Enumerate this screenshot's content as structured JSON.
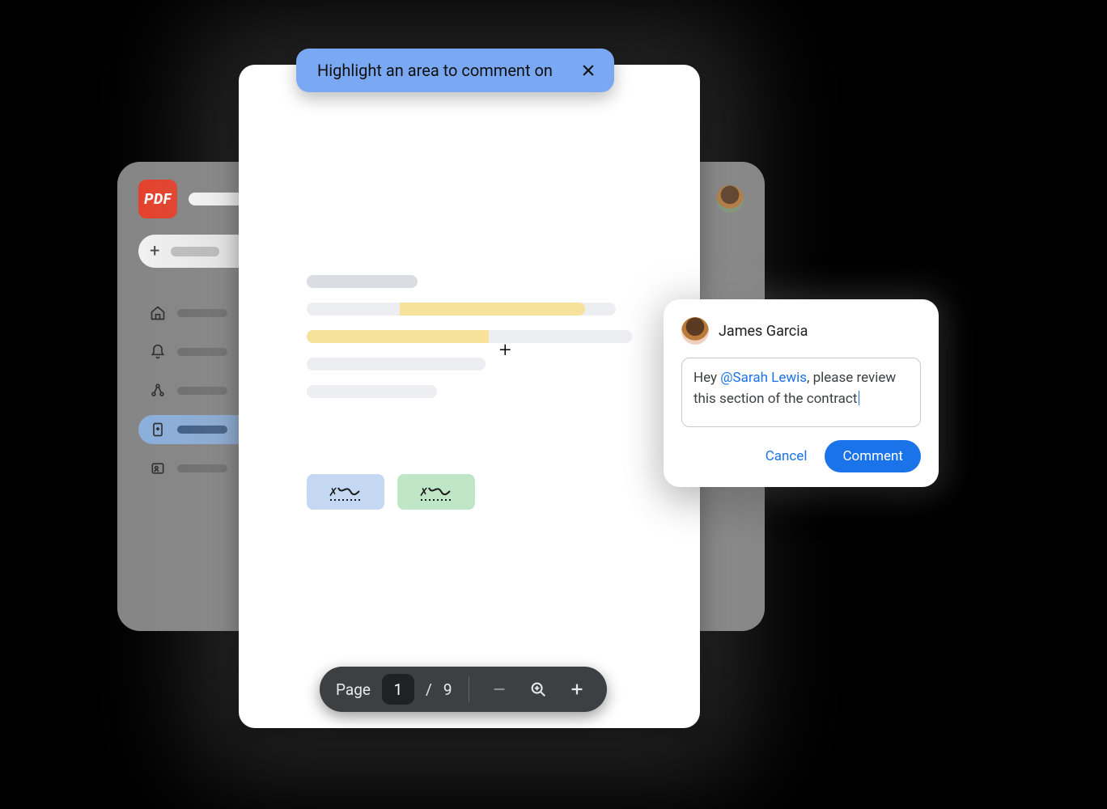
{
  "app": {
    "logo_text": "PDF"
  },
  "banner": {
    "text": "Highlight an area to comment on"
  },
  "pager": {
    "label": "Page",
    "current": "1",
    "separator": "/",
    "total": "9"
  },
  "comment": {
    "author": "James Garcia",
    "text_pre": "Hey ",
    "mention": "@Sarah Lewis",
    "text_post": ", please review this section of the contract",
    "cancel": "Cancel",
    "submit": "Comment"
  },
  "signatures": {
    "glyph": "✗"
  },
  "colors": {
    "banner": "#7aa8f2",
    "highlight": "#f8e19a",
    "primary": "#1a73e8"
  }
}
